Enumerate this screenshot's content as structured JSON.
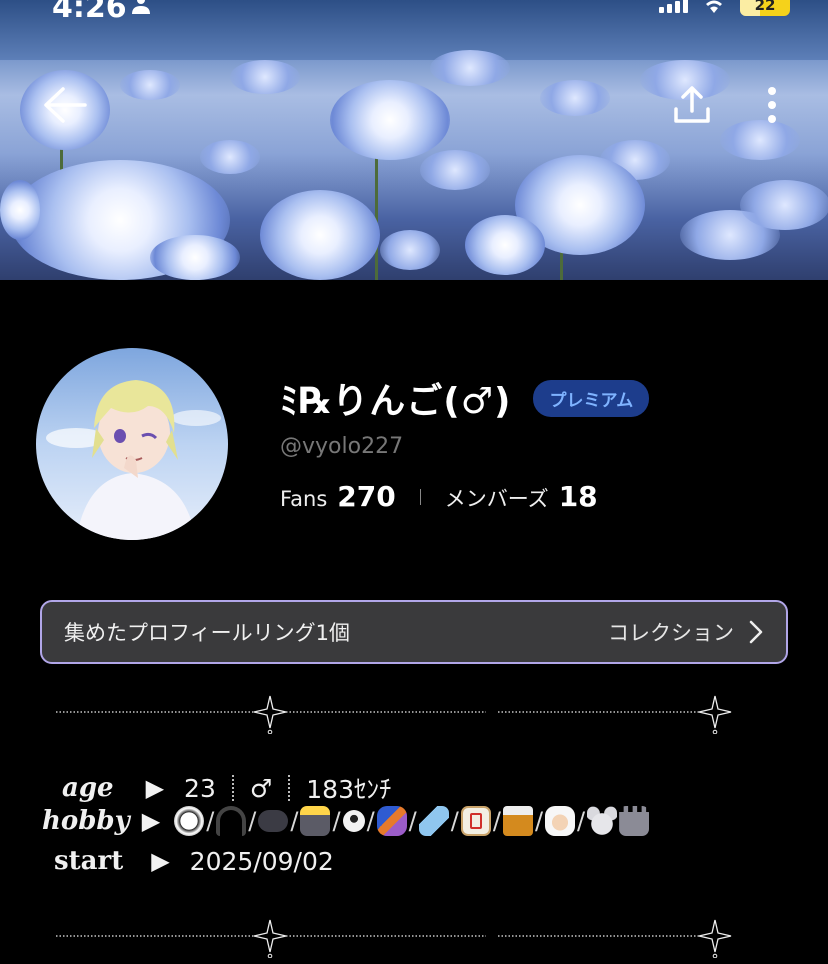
{
  "status_bar": {
    "time": "4:26",
    "battery": "22"
  },
  "profile": {
    "name": "ﾐ℞りんご(♂)",
    "badge": "プレミアム",
    "handle": "@vyolo227",
    "fans_label": "Fans",
    "fans_count": "270",
    "members_label": "メンバーズ",
    "members_count": "18"
  },
  "collection": {
    "label": "集めたプロフィールリング1個",
    "link": "コレクション"
  },
  "bio": {
    "age_label": "age",
    "age_value": "23",
    "gender": "♂",
    "height": "183ｾﾝﾁ",
    "hobby_label": "hobby",
    "hobby_icons": [
      "soccer-ball-icon",
      "headphones-icon",
      "game-controller-icon",
      "camera-flash-icon",
      "sunglasses-face-icon",
      "snowboarder-icon",
      "airplane-icon",
      "mahjong-tile-icon",
      "whisky-glass-icon",
      "bride-icon",
      "mouse-face-icon",
      "castle-icon"
    ],
    "start_label": "start",
    "start_value": "2025/09/02",
    "arrow": "▶"
  },
  "colors": {
    "premium_bg": "#1d3d8c",
    "premium_text": "#7fb3ff",
    "collection_border": "#b1a6e8"
  }
}
